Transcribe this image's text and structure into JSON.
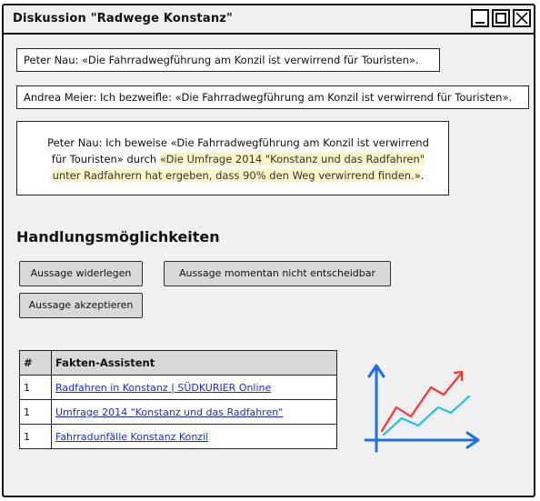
{
  "window": {
    "title": "Diskussion \"Radwege Konstanz\""
  },
  "statements": [
    {
      "text": "Peter Nau: «Die Fahrradwegführung am Konzil ist verwirrend für Touristen»."
    },
    {
      "text": "Andrea Meier: Ich bezweifle: «Die Fahrradwegführung am Konzil ist verwirrend für Touristen»."
    },
    {
      "prefix": "Peter Nau: Ich beweise «Die Fahrradwegführung am Konzil ist verwirrend für Touristen» durch ",
      "highlight": "«Die Umfrage 2014 \"Konstanz und das Radfahren\" unter Radfahrern hat ergeben, dass 90% den Weg verwirrend finden.»",
      "suffix": "."
    }
  ],
  "actions": {
    "heading": "Handlungsmöglichkeiten",
    "refute": "Aussage widerlegen",
    "undecidable": "Aussage momentan nicht entscheidbar",
    "accept": "Aussage akzeptieren"
  },
  "facts": {
    "col_num": "#",
    "col_title": "Fakten-Assistent",
    "rows": [
      {
        "num": "1",
        "link": "Radfahren in Konstanz | SÜDKURIER Online"
      },
      {
        "num": "1",
        "link": "Umfrage 2014 \"Konstanz und das Radfahren\""
      },
      {
        "num": "1",
        "link": "Fahrradunfälle Konstanz Konzil"
      }
    ]
  },
  "colors": {
    "highlight": "#fbf6c8",
    "link": "#1a2bd6",
    "chart_axis": "#1e6fe8",
    "chart_line_red": "#ff3333",
    "chart_line_cyan": "#22c3e6"
  },
  "icons": {
    "chart": "trend-chart-icon"
  }
}
